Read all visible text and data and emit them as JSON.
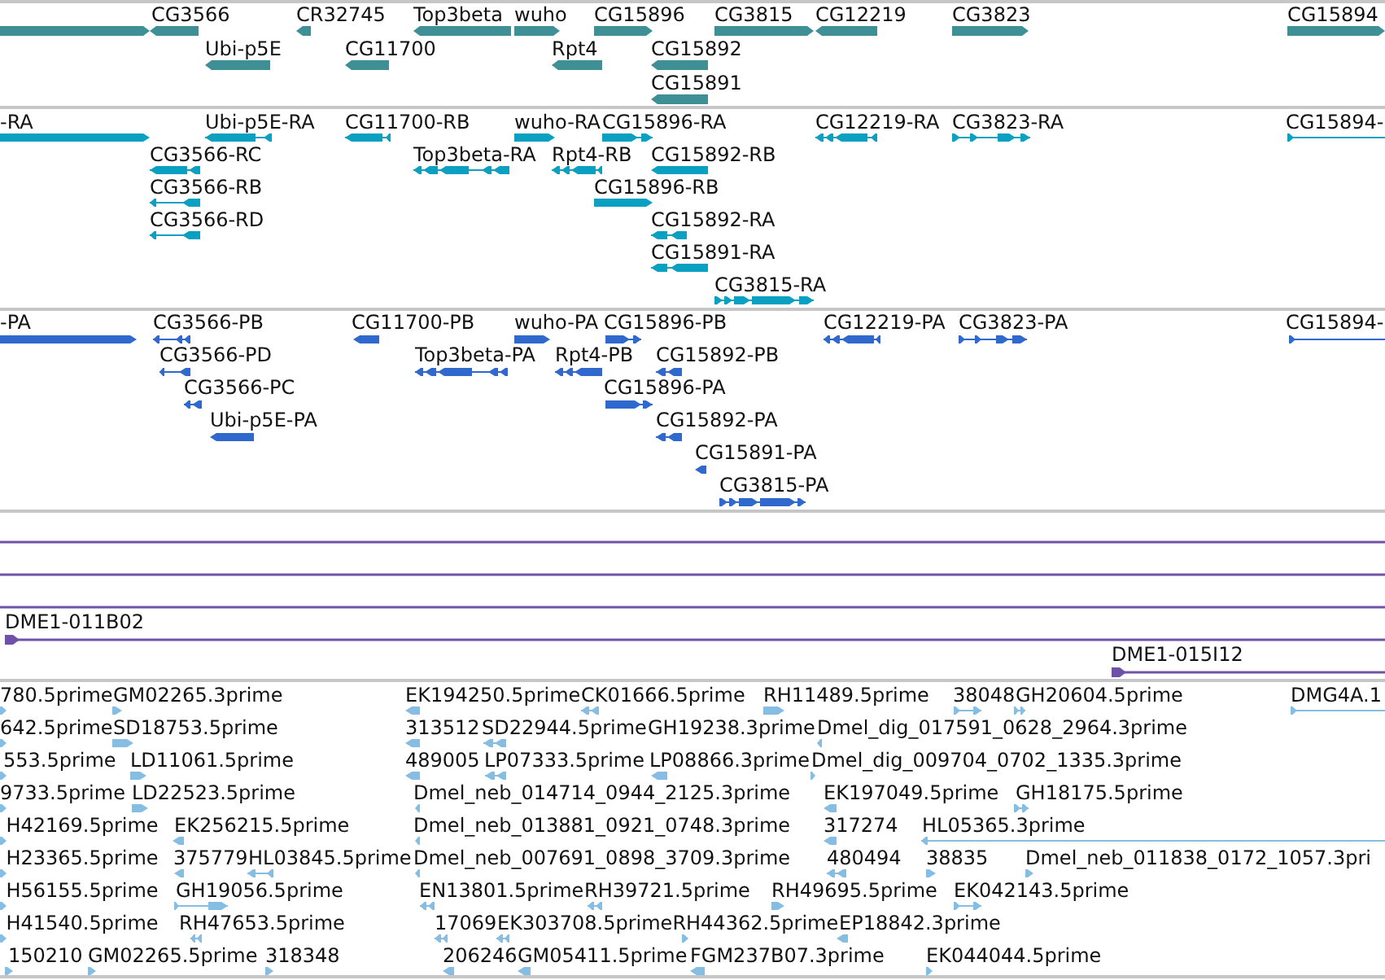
{
  "tracks": [
    {
      "kind": "gene",
      "color": "#3f8f97",
      "features": [
        {
          "reverse_strand": false
        },
        {
          "label": "CG3566",
          "reverse_strand": true
        },
        {
          "label": "CR32745",
          "reverse_strand": true
        },
        {
          "label": "Top3beta",
          "reverse_strand": true
        },
        {
          "label": "wuho",
          "reverse_strand": false
        },
        {
          "label": "CG15896",
          "reverse_strand": false
        },
        {
          "label": "CG3815",
          "reverse_strand": false
        },
        {
          "label": "CG12219",
          "reverse_strand": true
        },
        {
          "label": "CG3823",
          "reverse_strand": false
        },
        {
          "label": "CG15894",
          "reverse_strand": false
        },
        {
          "label": "Ubi-p5E",
          "reverse_strand": true
        },
        {
          "label": "CG11700",
          "reverse_strand": true
        },
        {
          "label": "Rpt4",
          "reverse_strand": true
        },
        {
          "label": "CG15892",
          "reverse_strand": true
        },
        {
          "label": "CG15891",
          "reverse_strand": true
        }
      ]
    },
    {
      "kind": "transcript",
      "color": "#0aa0c2",
      "features": [
        {
          "label": "-RA",
          "reverse_strand": false
        },
        {
          "label": "Ubi-p5E-RA",
          "reverse_strand": true
        },
        {
          "label": "CG11700-RB",
          "reverse_strand": true
        },
        {
          "label": "wuho-RA",
          "reverse_strand": false
        },
        {
          "label": "CG15896-RA",
          "reverse_strand": false
        },
        {
          "label": "CG12219-RA",
          "reverse_strand": true
        },
        {
          "label": "CG3823-RA",
          "reverse_strand": false
        },
        {
          "label": "CG15894-",
          "reverse_strand": false
        },
        {
          "label": "CG3566-RC",
          "reverse_strand": true
        },
        {
          "label": "Top3beta-RA",
          "reverse_strand": true
        },
        {
          "label": "Rpt4-RB",
          "reverse_strand": true
        },
        {
          "label": "CG15892-RB",
          "reverse_strand": true
        },
        {
          "label": "CG3566-RB",
          "reverse_strand": true
        },
        {
          "label": "CG15896-RB",
          "reverse_strand": false
        },
        {
          "label": "CG3566-RD",
          "reverse_strand": true
        },
        {
          "label": "CG15892-RA",
          "reverse_strand": true
        },
        {
          "label": "CG15891-RA",
          "reverse_strand": true
        },
        {
          "label": "CG3815-RA",
          "reverse_strand": false
        }
      ]
    },
    {
      "kind": "protein",
      "color": "#2f69cd",
      "features": [
        {
          "label": "-PA",
          "reverse_strand": false
        },
        {
          "label": "CG3566-PB",
          "reverse_strand": true
        },
        {
          "label": "CG11700-PB",
          "reverse_strand": true
        },
        {
          "label": "wuho-PA",
          "reverse_strand": false
        },
        {
          "label": "CG15896-PB",
          "reverse_strand": false
        },
        {
          "label": "CG12219-PA",
          "reverse_strand": true
        },
        {
          "label": "CG3823-PA",
          "reverse_strand": false
        },
        {
          "label": "CG15894-",
          "reverse_strand": false
        },
        {
          "label": "CG3566-PD",
          "reverse_strand": true
        },
        {
          "label": "Top3beta-PA",
          "reverse_strand": true
        },
        {
          "label": "Rpt4-PB",
          "reverse_strand": true
        },
        {
          "label": "CG15892-PB",
          "reverse_strand": true
        },
        {
          "label": "CG3566-PC",
          "reverse_strand": true
        },
        {
          "label": "CG15896-PA",
          "reverse_strand": false
        },
        {
          "label": "Ubi-p5E-PA",
          "reverse_strand": true
        },
        {
          "label": "CG15892-PA",
          "reverse_strand": true
        },
        {
          "label": "CG15891-PA",
          "reverse_strand": true
        },
        {
          "label": "CG3815-PA",
          "reverse_strand": false
        }
      ]
    },
    {
      "kind": "clone",
      "color": "#6f52a8",
      "features": [
        {
          "kind": "span"
        },
        {
          "kind": "span"
        },
        {
          "kind": "span"
        },
        {
          "kind": "clone",
          "label": "DME1-011B02",
          "reverse_strand": false
        },
        {
          "kind": "clone",
          "label": "DME1-015I12",
          "reverse_strand": false
        }
      ]
    },
    {
      "kind": "est",
      "color": "#86bde2",
      "features": [
        {
          "label": "780.5prime",
          "reverse_strand": false
        },
        {
          "label": "GM02265.3prime",
          "reverse_strand": false
        },
        {
          "label": "EK194250.5prime",
          "reverse_strand": true
        },
        {
          "label": "CK01666.5prime",
          "reverse_strand": true
        },
        {
          "label": "RH11489.5prime",
          "reverse_strand": false
        },
        {
          "label": "38048",
          "reverse_strand": false
        },
        {
          "label": "GH20604.5prime",
          "reverse_strand": false
        },
        {
          "label": "DMG4A.1",
          "reverse_strand": false
        },
        {
          "label": "642.5prime",
          "reverse_strand": false
        },
        {
          "label": "SD18753.5prime",
          "reverse_strand": false
        },
        {
          "label": "313512",
          "reverse_strand": true
        },
        {
          "label": "SD22944.5prime",
          "reverse_strand": true
        },
        {
          "label": "GH19238.3prime"
        },
        {
          "label": "Dmel_dig_017591_0628_2964.3prime",
          "reverse_strand": true
        },
        {
          "label": "553.5prime",
          "reverse_strand": false
        },
        {
          "label": "LD11061.5prime",
          "reverse_strand": false
        },
        {
          "label": "489005",
          "reverse_strand": true
        },
        {
          "label": "LP07333.5prime",
          "reverse_strand": true
        },
        {
          "label": "LP08866.3prime",
          "reverse_strand": true
        },
        {
          "label": "Dmel_dig_009704_0702_1335.3prime",
          "reverse_strand": false
        },
        {
          "label": "9733.5prime",
          "reverse_strand": false
        },
        {
          "label": "LD22523.5prime",
          "reverse_strand": false
        },
        {
          "label": "Dmel_neb_014714_0944_2125.3prime",
          "reverse_strand": true
        },
        {
          "label": "EK197049.5prime",
          "reverse_strand": true
        },
        {
          "label": "GH18175.5prime",
          "reverse_strand": false
        },
        {
          "label": "H42169.5prime",
          "reverse_strand": false
        },
        {
          "label": "EK256215.5prime",
          "reverse_strand": true
        },
        {
          "label": "Dmel_neb_013881_0921_0748.3prime",
          "reverse_strand": true
        },
        {
          "label": "317274",
          "reverse_strand": true
        },
        {
          "label": "HL05365.3prime",
          "reverse_strand": true
        },
        {
          "label": "H23365.5prime",
          "reverse_strand": false
        },
        {
          "label": "375779",
          "reverse_strand": true
        },
        {
          "label": "HL03845.5prime",
          "reverse_strand": true
        },
        {
          "label": "Dmel_neb_007691_0898_3709.3prime",
          "reverse_strand": true
        },
        {
          "label": "480494",
          "reverse_strand": true
        },
        {
          "label": "38835",
          "reverse_strand": false
        },
        {
          "label": "Dmel_neb_011838_0172_1057.3pri",
          "reverse_strand": false
        },
        {
          "label": "H56155.5prime",
          "reverse_strand": false
        },
        {
          "label": "GH19056.5prime",
          "reverse_strand": false
        },
        {
          "label": "EN13801.5prime",
          "reverse_strand": true
        },
        {
          "label": "RH39721.5prime",
          "reverse_strand": true
        },
        {
          "label": "RH49695.5prime",
          "reverse_strand": false
        },
        {
          "label": "EK042143.5prime",
          "reverse_strand": false
        },
        {
          "label": "H41540.5prime",
          "reverse_strand": false
        },
        {
          "label": "RH47653.5prime",
          "reverse_strand": true
        },
        {
          "label": "17069",
          "reverse_strand": true
        },
        {
          "label": "EK303708.5prime",
          "reverse_strand": true
        },
        {
          "label": "RH44362.5prime",
          "reverse_strand": false
        },
        {
          "label": "EP18842.3prime",
          "reverse_strand": true
        },
        {
          "label": "150210",
          "reverse_strand": false
        },
        {
          "label": "GM02265.5prime",
          "reverse_strand": false
        },
        {
          "label": "318348",
          "reverse_strand": false
        },
        {
          "label": "206246",
          "reverse_strand": true
        },
        {
          "label": "GM05411.5prime",
          "reverse_strand": true
        },
        {
          "label": "FGM237B07.3prime",
          "reverse_strand": true
        },
        {
          "label": "EK044044.5prime",
          "reverse_strand": false
        }
      ]
    }
  ]
}
